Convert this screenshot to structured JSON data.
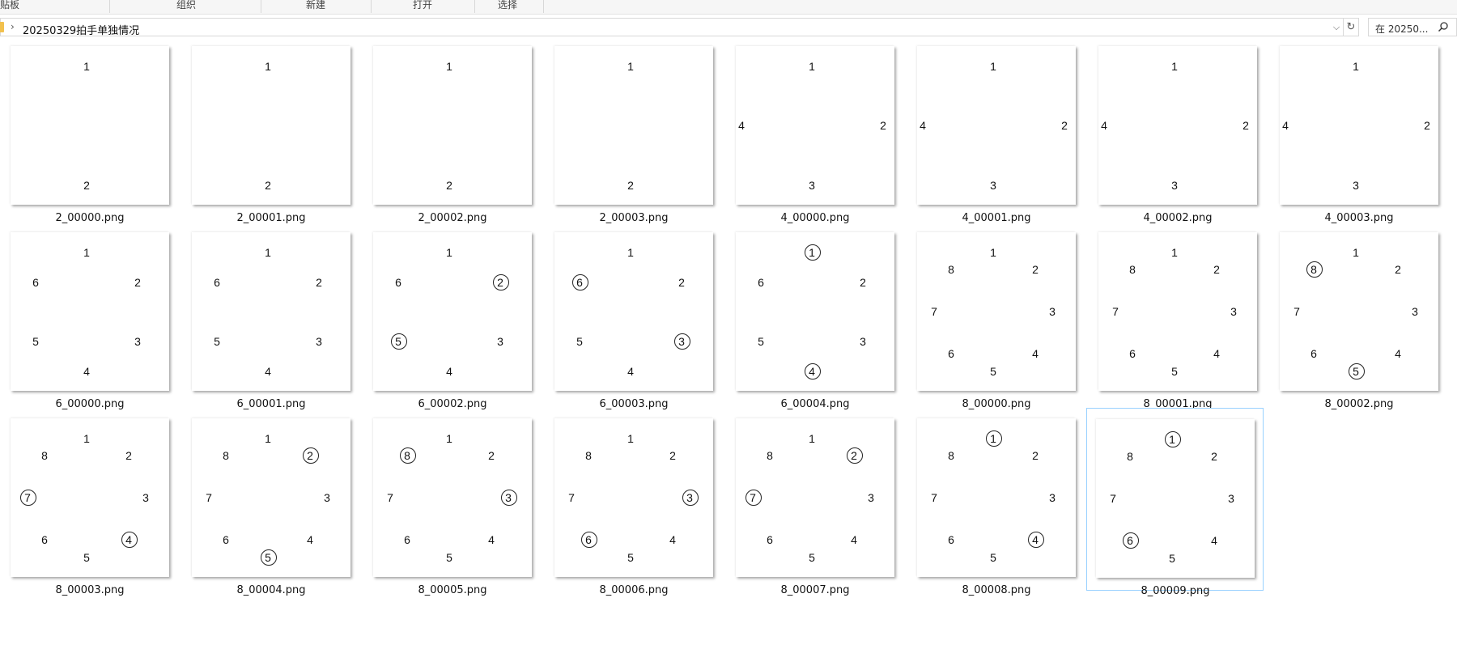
{
  "ribbon": {
    "groups": [
      "贴板",
      "组织",
      "新建",
      "打开",
      "选择"
    ]
  },
  "address": {
    "path": "20250329拍手单独情况",
    "arrow": "›",
    "dropdown": "⌵",
    "refresh": "↻"
  },
  "search": {
    "placeholder": "在 20250..."
  },
  "files": [
    {
      "name": "2_00000.png",
      "count": 2,
      "circled": []
    },
    {
      "name": "2_00001.png",
      "count": 2,
      "circled": []
    },
    {
      "name": "2_00002.png",
      "count": 2,
      "circled": []
    },
    {
      "name": "2_00003.png",
      "count": 2,
      "circled": []
    },
    {
      "name": "4_00000.png",
      "count": 4,
      "circled": []
    },
    {
      "name": "4_00001.png",
      "count": 4,
      "circled": []
    },
    {
      "name": "4_00002.png",
      "count": 4,
      "circled": []
    },
    {
      "name": "4_00003.png",
      "count": 4,
      "circled": []
    },
    {
      "name": "6_00000.png",
      "count": 6,
      "circled": []
    },
    {
      "name": "6_00001.png",
      "count": 6,
      "circled": []
    },
    {
      "name": "6_00002.png",
      "count": 6,
      "circled": [
        2,
        5
      ]
    },
    {
      "name": "6_00003.png",
      "count": 6,
      "circled": [
        6,
        3
      ]
    },
    {
      "name": "6_00004.png",
      "count": 6,
      "circled": [
        1,
        4
      ]
    },
    {
      "name": "8_00000.png",
      "count": 8,
      "circled": []
    },
    {
      "name": "8_00001.png",
      "count": 8,
      "circled": []
    },
    {
      "name": "8_00002.png",
      "count": 8,
      "circled": [
        8,
        5
      ]
    },
    {
      "name": "8_00003.png",
      "count": 8,
      "circled": [
        7,
        4
      ]
    },
    {
      "name": "8_00004.png",
      "count": 8,
      "circled": [
        2,
        5
      ]
    },
    {
      "name": "8_00005.png",
      "count": 8,
      "circled": [
        8,
        3
      ]
    },
    {
      "name": "8_00006.png",
      "count": 8,
      "circled": [
        6,
        3
      ]
    },
    {
      "name": "8_00007.png",
      "count": 8,
      "circled": [
        2,
        7
      ]
    },
    {
      "name": "8_00008.png",
      "count": 8,
      "circled": [
        1,
        4
      ]
    },
    {
      "name": "8_00009.png",
      "count": 8,
      "circled": [
        1,
        6
      ],
      "selected": true
    }
  ]
}
